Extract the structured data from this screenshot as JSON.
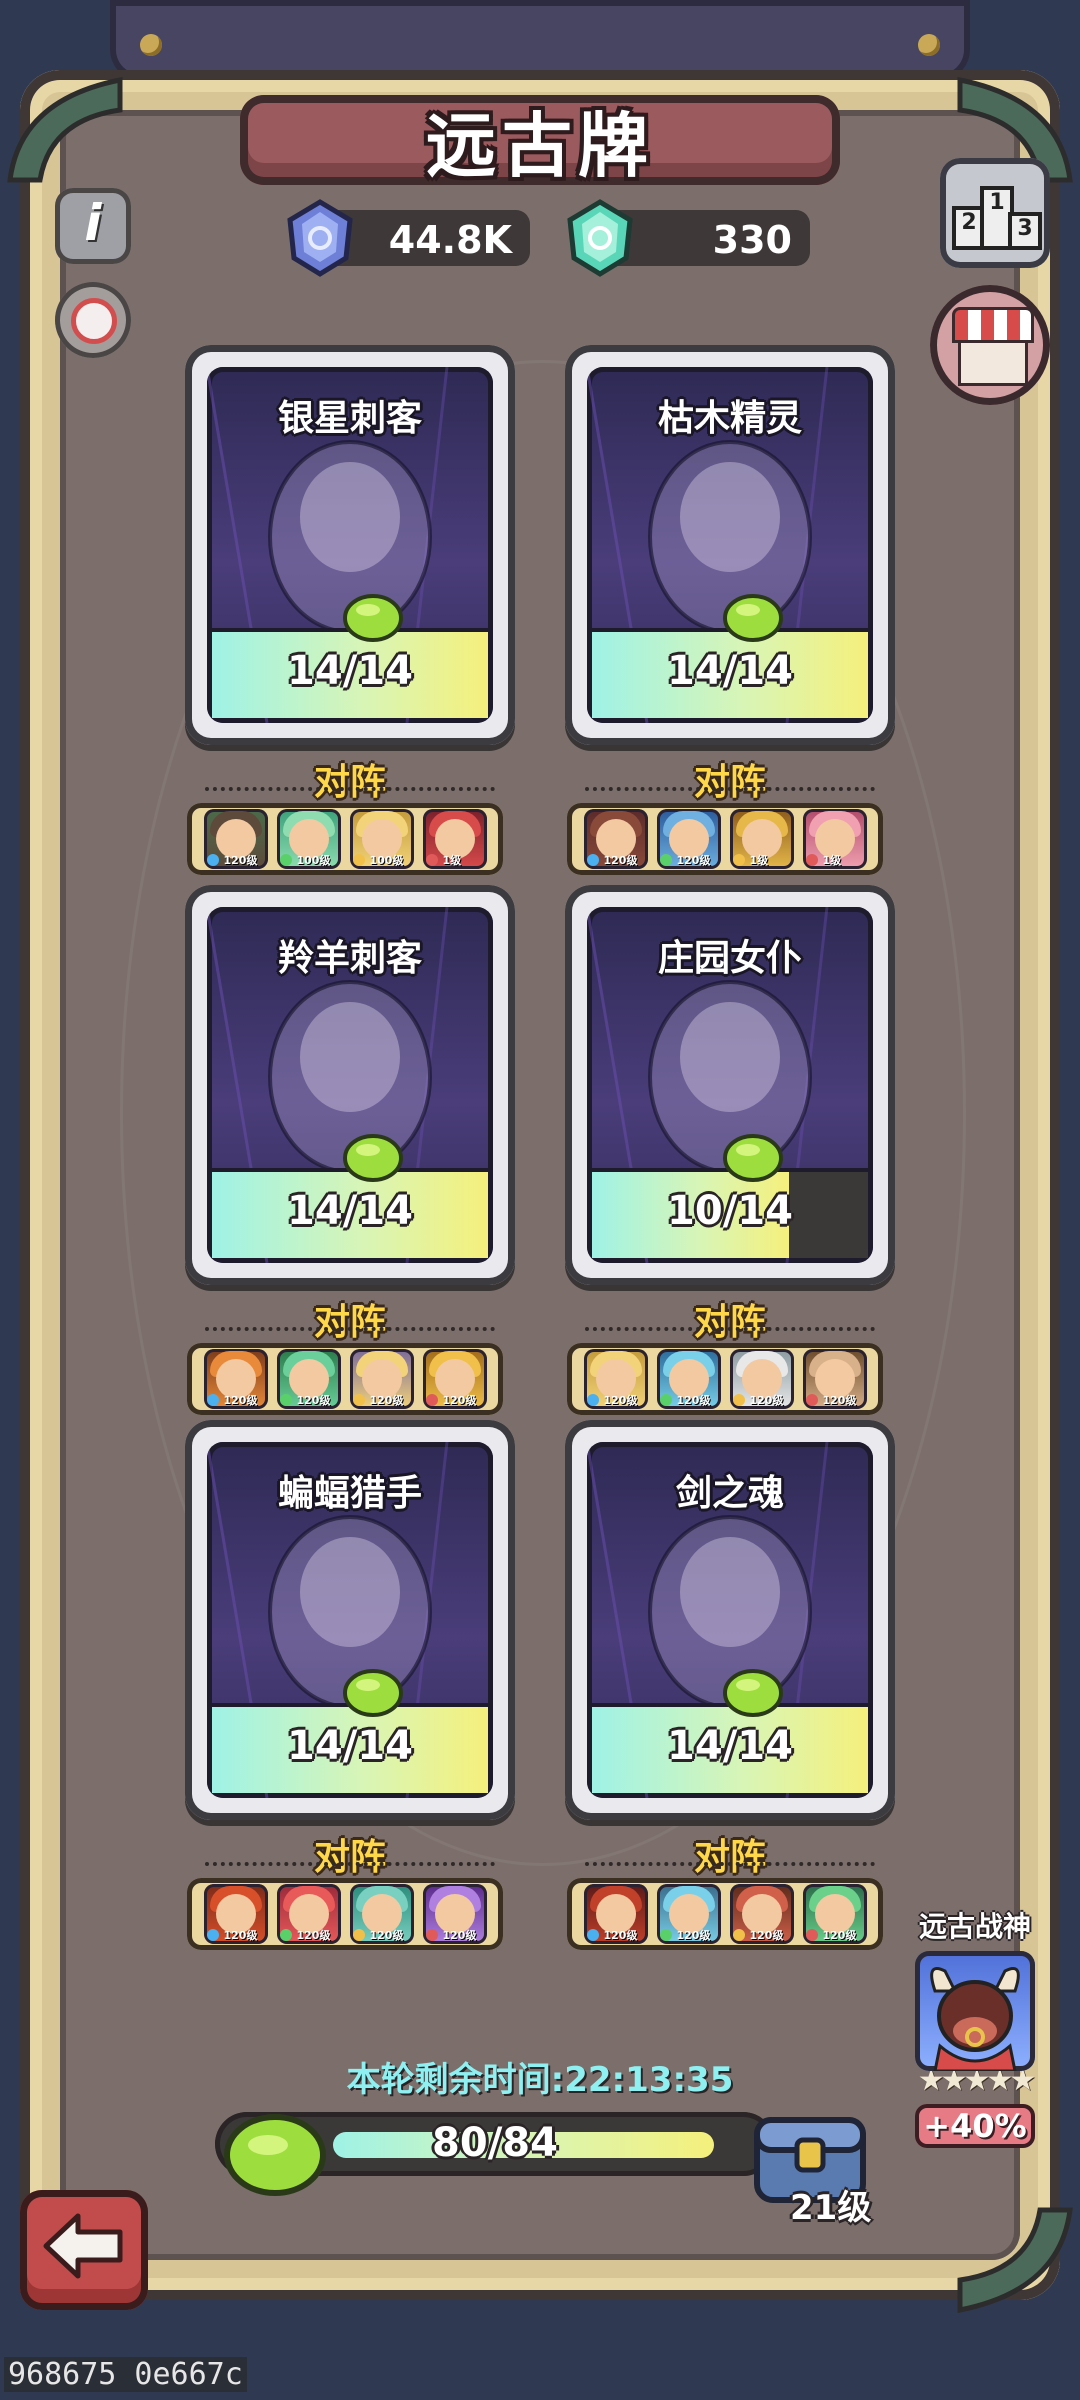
{
  "header": {
    "title": "远古牌"
  },
  "currency": {
    "blue_gem": {
      "icon": "blue-gem-icon",
      "value": "44.8K"
    },
    "green_gem": {
      "icon": "green-gem-icon",
      "value": "330"
    }
  },
  "side_buttons": {
    "info": "i",
    "rank_podium": [
      "2",
      "1",
      "3"
    ]
  },
  "cards": [
    {
      "name": "银星刺客",
      "progress": "14/14",
      "fill": 1.0,
      "lineup_label": "对阵",
      "heroes": [
        "120级",
        "100级",
        "100级",
        "1级"
      ]
    },
    {
      "name": "枯木精灵",
      "progress": "14/14",
      "fill": 1.0,
      "lineup_label": "对阵",
      "heroes": [
        "120级",
        "120级",
        "1级",
        "1级"
      ]
    },
    {
      "name": "羚羊刺客",
      "progress": "14/14",
      "fill": 1.0,
      "lineup_label": "对阵",
      "heroes": [
        "120级",
        "120级",
        "120级",
        "120级"
      ]
    },
    {
      "name": "庄园女仆",
      "progress": "10/14",
      "fill": 0.714,
      "lineup_label": "对阵",
      "heroes": [
        "120级",
        "120级",
        "120级",
        "120级"
      ]
    },
    {
      "name": "蝙蝠猎手",
      "progress": "14/14",
      "fill": 1.0,
      "lineup_label": "对阵",
      "heroes": [
        "120级",
        "120级",
        "120级",
        "120级"
      ]
    },
    {
      "name": "剑之魂",
      "progress": "14/14",
      "fill": 1.0,
      "lineup_label": "对阵",
      "heroes": [
        "120级",
        "120级",
        "120级",
        "120级"
      ]
    }
  ],
  "round_timer": {
    "label": "本轮剩余时间:",
    "time": "22:13:35"
  },
  "overall_progress": {
    "text": "80/84",
    "fill": 0.952,
    "level": "21级"
  },
  "ancient_god": {
    "title": "远古战神",
    "stars": "★★★★★",
    "bonus": "+40%"
  },
  "watermark": "968675 0e667c",
  "colors": {
    "gold_text": "#ffd84a",
    "timer_cyan": "#8ff0f2",
    "bonus_pink": "#e67b86",
    "panel_brown": "#7c6f6b"
  }
}
